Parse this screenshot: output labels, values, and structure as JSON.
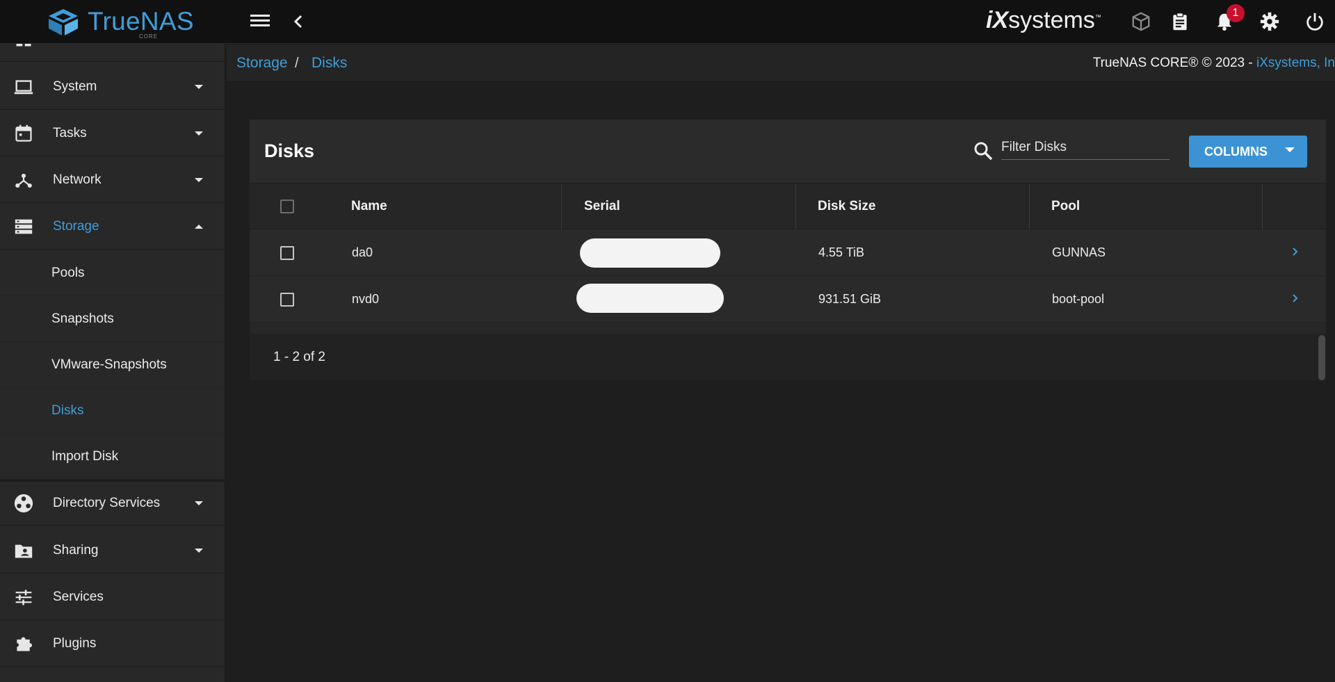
{
  "header": {
    "logo_text": "TrueNAS",
    "logo_sub": "CORE",
    "vendor_logo_ix": "iX",
    "vendor_logo_systems": "systems",
    "notification_count": "1",
    "icons": [
      "menu-icon",
      "back-icon",
      "truecommand-icon",
      "clipboard-icon",
      "bell-icon",
      "gear-icon",
      "power-icon"
    ]
  },
  "breadcrumb": {
    "items": [
      "Storage",
      "Disks"
    ],
    "separator": "/"
  },
  "copyright": {
    "text": "TrueNAS CORE® © 2023 - ",
    "link": "iXsystems, In"
  },
  "sidebar": {
    "items": [
      {
        "label": "System",
        "icon": "laptop-icon",
        "expanded": false
      },
      {
        "label": "Tasks",
        "icon": "calendar-icon",
        "expanded": false
      },
      {
        "label": "Network",
        "icon": "network-icon",
        "expanded": false
      },
      {
        "label": "Storage",
        "icon": "storage-icon",
        "expanded": true,
        "active": true
      },
      {
        "label": "Directory Services",
        "icon": "directory-icon",
        "expanded": false
      },
      {
        "label": "Sharing",
        "icon": "folder-share-icon",
        "expanded": false
      },
      {
        "label": "Services",
        "icon": "sliders-icon"
      },
      {
        "label": "Plugins",
        "icon": "puzzle-icon"
      }
    ],
    "storage_children": [
      "Pools",
      "Snapshots",
      "VMware-Snapshots",
      "Disks",
      "Import Disk"
    ],
    "active_child": "Disks"
  },
  "disks_card": {
    "title": "Disks",
    "filter_placeholder": "Filter Disks",
    "columns_button": "COLUMNS",
    "headers": [
      "Name",
      "Serial",
      "Disk Size",
      "Pool"
    ],
    "rows": [
      {
        "name": "da0",
        "serial": "",
        "size": "4.55 TiB",
        "pool": "GUNNAS"
      },
      {
        "name": "nvd0",
        "serial": "",
        "size": "931.51 GiB",
        "pool": "boot-pool"
      }
    ],
    "pagination": "1 - 2 of 2"
  },
  "colors": {
    "accent": "#3f9ed8",
    "button": "#3b93d6",
    "badge": "#c8102e",
    "topbar": "#111111",
    "sidebar": "#282828"
  }
}
